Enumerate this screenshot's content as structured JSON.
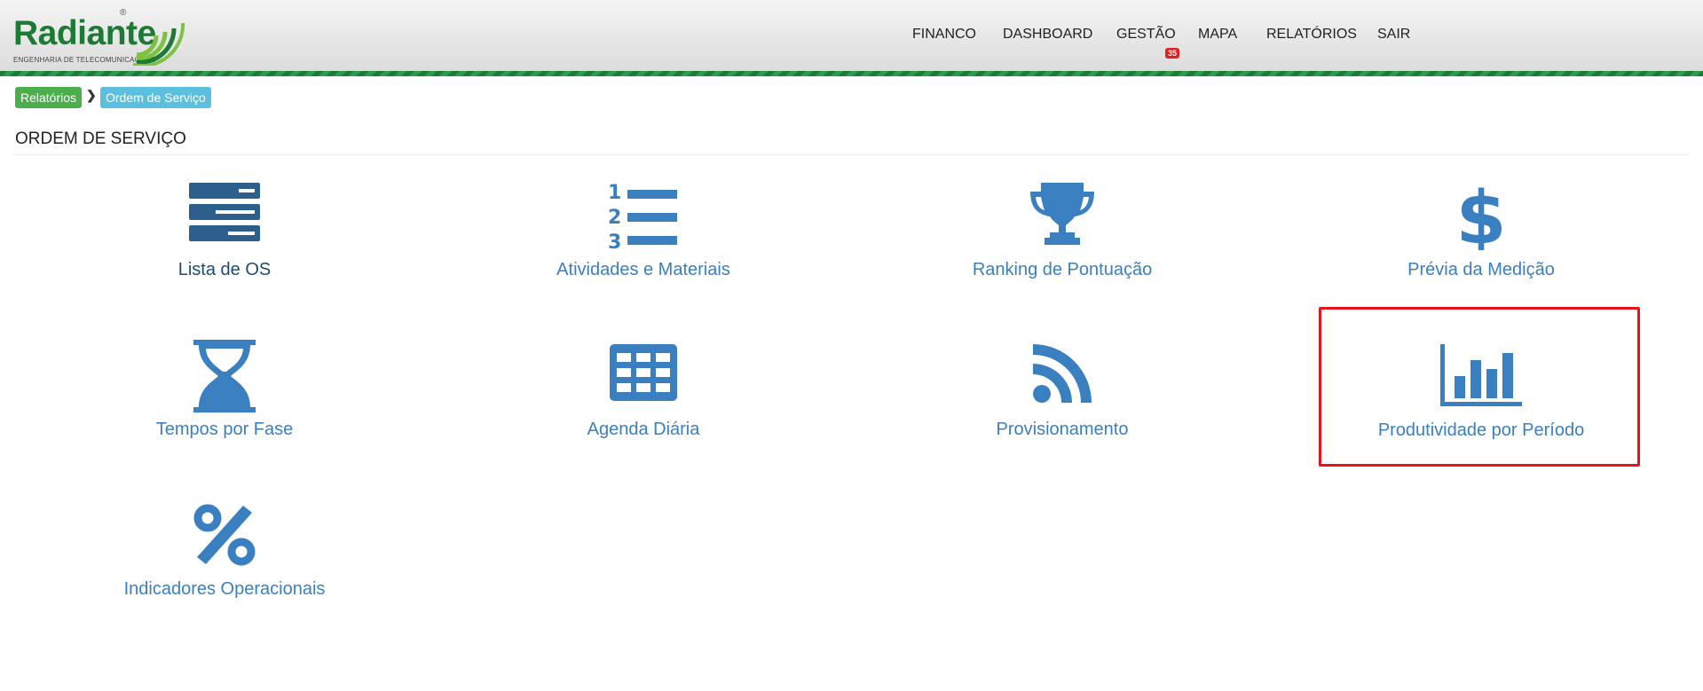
{
  "brand": {
    "name": "Radiante",
    "tagline": "ENGENHARIA DE TELECOMUNICAÇÕES",
    "registered": "®",
    "colors": {
      "green": "#1c7a35",
      "lime": "#7dc242"
    }
  },
  "nav": {
    "items": [
      {
        "label": "FINANCO"
      },
      {
        "label": "DASHBOARD"
      },
      {
        "label": "GESTÃO",
        "badge": "35"
      },
      {
        "label": "MAPA"
      },
      {
        "label": "RELATÓRIOS"
      },
      {
        "label": "SAIR"
      }
    ]
  },
  "breadcrumb": {
    "items": [
      {
        "label": "Relatórios",
        "color": "#4cae4c"
      },
      {
        "label": "Ordem de Serviço",
        "color": "#5bc0de"
      }
    ]
  },
  "page": {
    "title": "ORDEM DE SERVIÇO"
  },
  "tiles": [
    {
      "label": "Lista de OS",
      "icon": "server-list-icon"
    },
    {
      "label": "Atividades e Materiais",
      "icon": "numbered-list-icon"
    },
    {
      "label": "Ranking de Pontuação",
      "icon": "trophy-icon"
    },
    {
      "label": "Prévia da Medição",
      "icon": "dollar-icon"
    },
    {
      "label": "Tempos por Fase",
      "icon": "hourglass-icon"
    },
    {
      "label": "Agenda Diária",
      "icon": "calendar-grid-icon"
    },
    {
      "label": "Provisionamento",
      "icon": "rss-feed-icon"
    },
    {
      "label": "Produtividade por Período",
      "icon": "bar-chart-icon",
      "highlighted": true
    },
    {
      "label": "Indicadores Operacionais",
      "icon": "percent-icon"
    }
  ],
  "colors": {
    "icon_blue": "#3a80c1",
    "icon_dark": "#2d5f8d",
    "highlight": "#e8131a",
    "badge": "#e02020"
  }
}
